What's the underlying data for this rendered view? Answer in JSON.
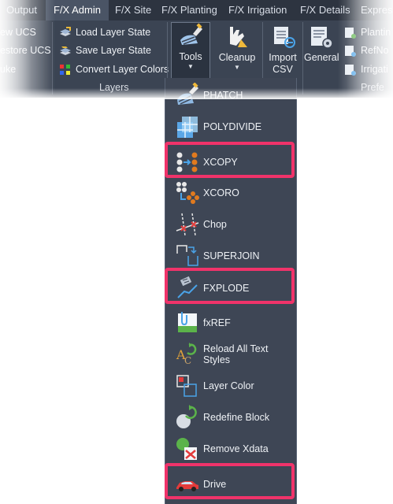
{
  "ribbon": {
    "tabs": [
      {
        "label": "Output"
      },
      {
        "label": "F/X Admin"
      },
      {
        "label": "F/X Site"
      },
      {
        "label": "F/X Planting"
      },
      {
        "label": "F/X Irrigation"
      },
      {
        "label": "F/X Details"
      },
      {
        "label": "Expres"
      }
    ],
    "left_items": [
      "ew UCS",
      "estore UCS",
      "uke"
    ],
    "layers_group": {
      "items": [
        "Load Layer State",
        "Save Layer State",
        "Convert Layer Colors"
      ],
      "label": "Layers"
    },
    "buttons": {
      "tools": "Tools",
      "cleanup": "Cleanup",
      "import_line1": "Import",
      "import_line2": "CSV",
      "general": "General"
    },
    "right_items": [
      "Plantin",
      "RefNo",
      "Irrigati"
    ],
    "right_group_label": "Prefe"
  },
  "menu": {
    "items": [
      {
        "label": "PHATCH",
        "icon": "phatch-icon"
      },
      {
        "label": "POLYDIVIDE",
        "icon": "polydivide-icon"
      },
      {
        "label": "XCOPY",
        "icon": "xcopy-icon"
      },
      {
        "label": "XCORO",
        "icon": "xcoro-icon"
      },
      {
        "label": "Chop",
        "icon": "chop-icon"
      },
      {
        "label": "SUPERJOIN",
        "icon": "superjoin-icon"
      },
      {
        "label": "FXPLODE",
        "icon": "fxplode-icon"
      },
      {
        "label": "fxREF",
        "icon": "fxref-icon"
      },
      {
        "label": "Reload All Text Styles",
        "icon": "reload-text-styles-icon"
      },
      {
        "label": "Layer Color",
        "icon": "layer-color-icon"
      },
      {
        "label": "Redefine Block",
        "icon": "redefine-block-icon"
      },
      {
        "label": "Remove Xdata",
        "icon": "remove-xdata-icon"
      },
      {
        "label": "Drive",
        "icon": "drive-car-icon"
      }
    ],
    "highlighted": [
      "XCOPY",
      "FXPLODE",
      "Drive"
    ]
  },
  "colors": {
    "ribbon_bg": "#3b4453",
    "dropdown_bg": "#3e4655",
    "highlight": "#f0336a",
    "accent_orange": "#e07a1f",
    "accent_blue": "#4aa3e8"
  }
}
